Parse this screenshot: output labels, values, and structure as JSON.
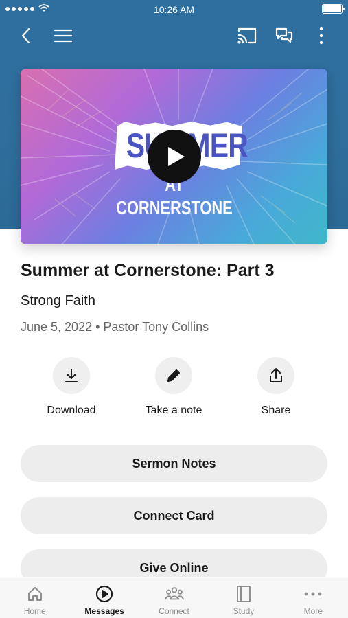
{
  "status_bar": {
    "time": "10:26 AM"
  },
  "hero": {
    "title_line1": "SUMMER",
    "title_line2": "AT CORNERSTONE"
  },
  "message": {
    "title": "Summer at Cornerstone: Part 3",
    "subtitle": "Strong Faith",
    "meta": "June 5, 2022 • Pastor Tony Collins"
  },
  "actions": [
    {
      "label": "Download",
      "icon": "download-icon"
    },
    {
      "label": "Take a note",
      "icon": "pencil-icon"
    },
    {
      "label": "Share",
      "icon": "share-icon"
    }
  ],
  "buttons": [
    {
      "label": "Sermon Notes"
    },
    {
      "label": "Connect Card"
    },
    {
      "label": "Give Online"
    }
  ],
  "tabs": [
    {
      "label": "Home",
      "icon": "home-icon",
      "active": false
    },
    {
      "label": "Messages",
      "icon": "play-circle-icon",
      "active": true
    },
    {
      "label": "Connect",
      "icon": "people-icon",
      "active": false
    },
    {
      "label": "Study",
      "icon": "book-icon",
      "active": false
    },
    {
      "label": "More",
      "icon": "ellipsis-icon",
      "active": false
    }
  ],
  "colors": {
    "header": "#2e6fa0",
    "pill_background": "#ededed",
    "tab_inactive": "#8e8e8e",
    "tab_active": "#1a1a1a"
  }
}
